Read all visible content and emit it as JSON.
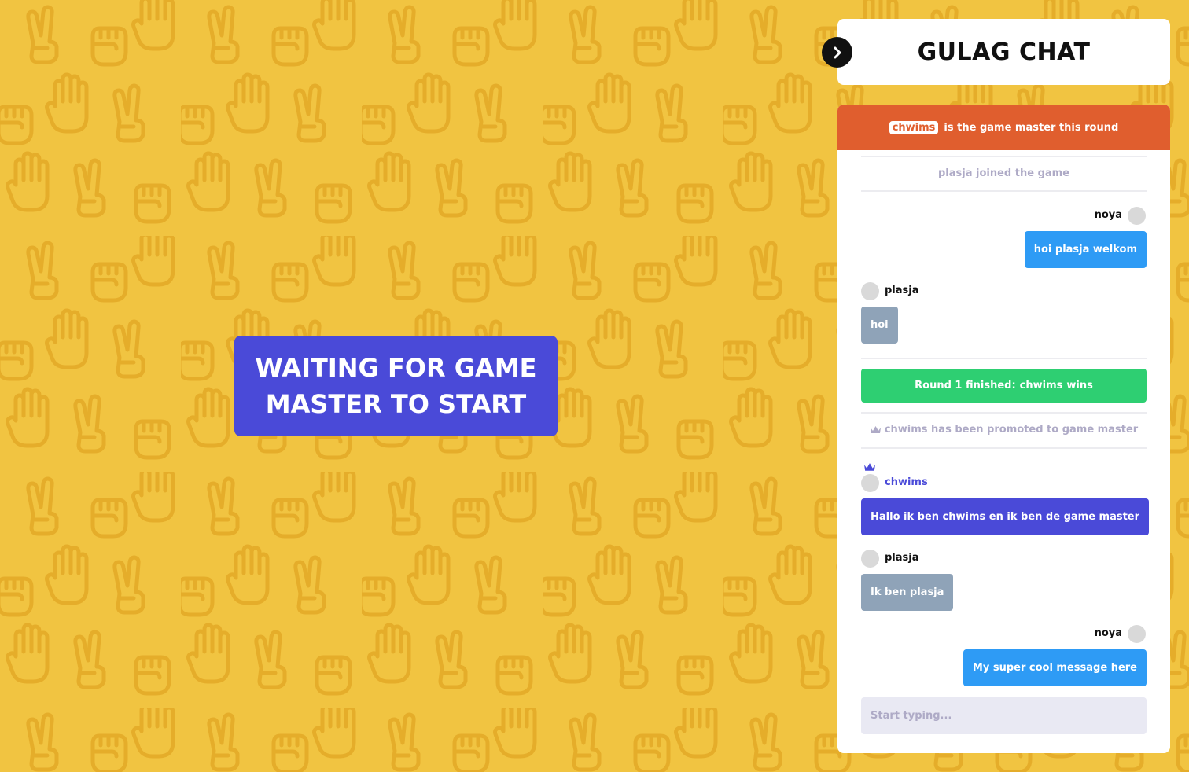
{
  "colors": {
    "background": "#f1c441",
    "pattern": "#e5ad2a",
    "waiting_box": "#4a4ad8",
    "gm_banner": "#e05e2e",
    "own_bubble": "#2e9bf5",
    "other_bubble": "#8fa3b8",
    "master_bubble": "#4a4ad8",
    "round_bar": "#2ecf72",
    "system_text": "#aeaac6"
  },
  "background": {
    "pattern_icons": [
      "peace-hand-icon",
      "fist-icon",
      "open-hand-icon"
    ]
  },
  "waiting": {
    "text": "WAITING FOR GAME MASTER TO START"
  },
  "toggle": {
    "icon": "chevron-right-icon"
  },
  "chat": {
    "title": "GULAG CHAT",
    "banner": {
      "name": "chwims",
      "text": "is the game master this round"
    },
    "system_joined": "plasja joined the game",
    "messages": [
      {
        "user": "noya",
        "text": "hoi plasja welkom"
      },
      {
        "user": "plasja",
        "text": "hoi"
      }
    ],
    "round": {
      "prefix": "Round 1 finished:",
      "winner": "chwims",
      "suffix": "wins"
    },
    "system_promoted": "chwims has been promoted to game master",
    "messages2": [
      {
        "user": "chwims",
        "text": "Hallo ik ben chwims en ik ben de game master"
      },
      {
        "user": "plasja",
        "text": "Ik ben plasja"
      },
      {
        "user": "noya",
        "text": "My super cool message here"
      }
    ],
    "input_placeholder": "Start typing..."
  }
}
